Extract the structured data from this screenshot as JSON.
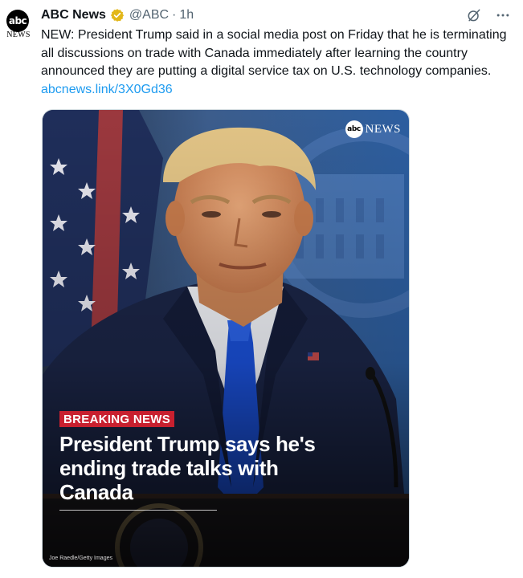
{
  "account": {
    "avatar_text": "abc",
    "avatar_subtext": "NEWS",
    "display_name": "ABC News",
    "handle": "@ABC",
    "separator": "·",
    "time": "1h"
  },
  "tweet": {
    "text": "NEW: President Trump said in a social media post on Friday that he is terminating all discussions on trade with Canada immediately after learning the country announced they are putting a digital service tax on U.S. technology companies.",
    "link": "abcnews.link/3X0Gd36"
  },
  "media": {
    "logo_circle": "abc",
    "logo_text": "NEWS",
    "badge": "BREAKING NEWS",
    "headline": "President Trump says he's ending trade talks with Canada",
    "credit": "Joe Raedle/Getty Images"
  },
  "icons": {
    "verified": "verified-badge-icon",
    "grok": "grok-icon",
    "more": "more-icon"
  },
  "colors": {
    "link": "#1d9bf0",
    "verified_gold": "#e2b719",
    "breaking_red": "#c8202f",
    "muted": "#536471"
  }
}
